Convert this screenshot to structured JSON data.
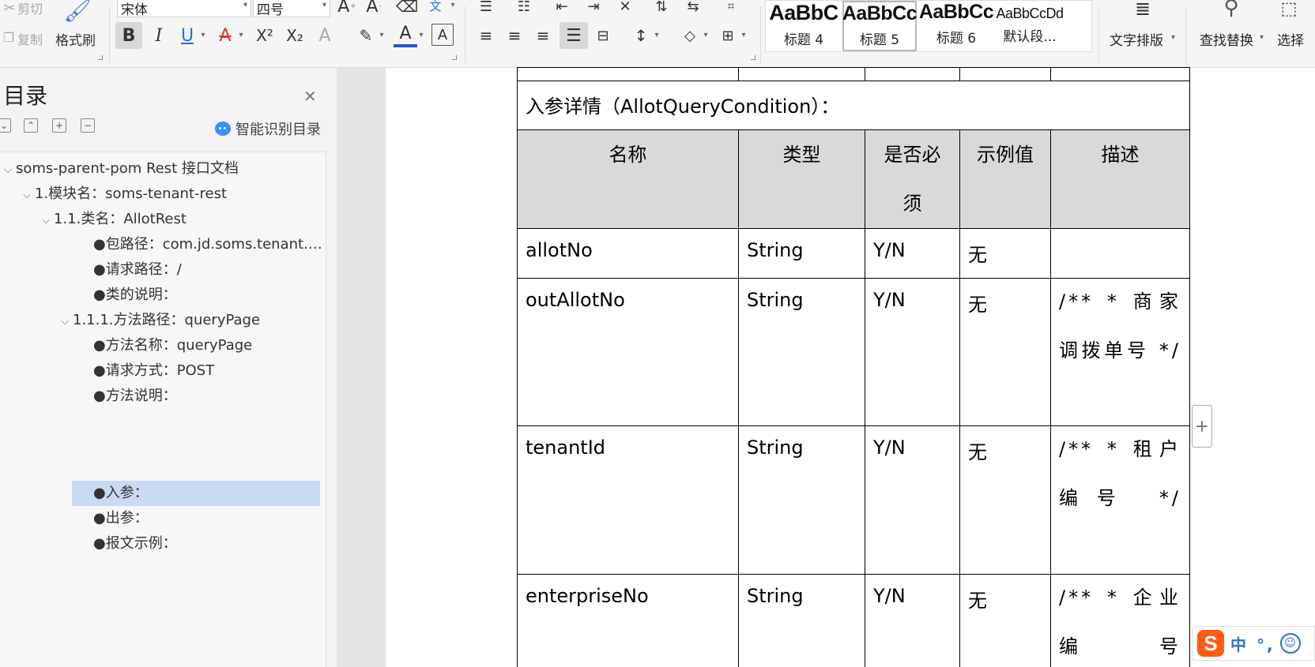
{
  "toolbar": {
    "cut_label": "剪切",
    "copy_label": "复制",
    "format_painter_label": "格式刷",
    "font_name": "宋体",
    "font_size": "四号",
    "bold_label": "B",
    "italic_label": "I",
    "underline_label": "U",
    "strike_label": "A",
    "superscript_label": "X²",
    "subscript_label": "X₂",
    "text_effect_label": "A",
    "highlight_label": "A",
    "font_color_label": "A",
    "char_border_label": "A",
    "styles": [
      {
        "sample": "AaBbC",
        "name": "标题 4"
      },
      {
        "sample": "AaBbCc",
        "name": "标题 5"
      },
      {
        "sample": "AaBbCc",
        "name": "标题 6"
      },
      {
        "sample": "AaBbCcDd",
        "name": "默认段..."
      }
    ],
    "text_layout_label": "文字排版",
    "find_replace_label": "查找替换",
    "select_label": "选择"
  },
  "sidebar": {
    "title": "目录",
    "smart_toc_label": "智能识别目录",
    "items": [
      {
        "label": "soms-parent-pom Rest 接口文档"
      },
      {
        "label": "1.模块名：soms-tenant-rest"
      },
      {
        "label": "1.1.类名：AllotRest"
      },
      {
        "label": "●包路径：com.jd.soms.tenant.…"
      },
      {
        "label": "●请求路径：/"
      },
      {
        "label": "●类的说明："
      },
      {
        "label": "1.1.1.方法路径：queryPage"
      },
      {
        "label": "●方法名称：queryPage"
      },
      {
        "label": "●请求方式：POST"
      },
      {
        "label": "●方法说明："
      },
      {
        "label": "●入参："
      },
      {
        "label": "●出参："
      },
      {
        "label": "●报文示例："
      }
    ]
  },
  "document": {
    "caption": "入参详情（AllotQueryCondition）：",
    "headers": [
      "名称",
      "类型",
      "是否必须",
      "示例值",
      "描述"
    ],
    "rows": [
      {
        "name": "allotNo",
        "type": "String",
        "required": "Y/N",
        "example": "无",
        "desc": ""
      },
      {
        "name": "outAllotNo",
        "type": "String",
        "required": "Y/N",
        "example": "无",
        "desc": "/** * 商家调拨单号 */"
      },
      {
        "name": "tenantId",
        "type": "String",
        "required": "Y/N",
        "example": "无",
        "desc": "/** * 租户编号 */"
      },
      {
        "name": "enterpriseNo",
        "type": "String",
        "required": "Y/N",
        "example": "无",
        "desc": "/** * 企业编号"
      }
    ]
  },
  "ime": {
    "logo": "S",
    "mode_text": "中 °,"
  }
}
